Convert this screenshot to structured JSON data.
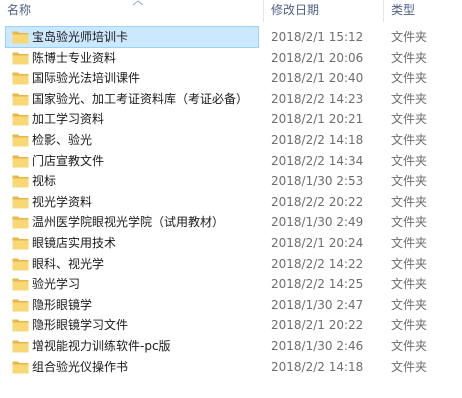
{
  "columns": {
    "name": "名称",
    "modified": "修改日期",
    "type": "类型"
  },
  "colors": {
    "header_text": "#4d6082",
    "selection_bg": "#cce8ff",
    "selection_border": "#99d1ff",
    "folder_front": "#f8d775",
    "folder_back": "#e8b649",
    "secondary_text": "#6d6d6d"
  },
  "selected_index": 0,
  "files": [
    {
      "name": "宝岛验光师培训卡",
      "date": "2018/2/1 15:12",
      "type": "文件夹",
      "icon": "folder-icon"
    },
    {
      "name": "陈博士专业资料",
      "date": "2018/2/1 20:06",
      "type": "文件夹",
      "icon": "folder-icon"
    },
    {
      "name": "国际验光法培训课件",
      "date": "2018/2/1 20:40",
      "type": "文件夹",
      "icon": "folder-icon"
    },
    {
      "name": "国家验光、加工考证资料库（考证必备）",
      "date": "2018/2/2 14:23",
      "type": "文件夹",
      "icon": "folder-icon"
    },
    {
      "name": "加工学习资料",
      "date": "2018/2/1 20:21",
      "type": "文件夹",
      "icon": "folder-icon"
    },
    {
      "name": "检影、验光",
      "date": "2018/2/2 14:18",
      "type": "文件夹",
      "icon": "folder-icon"
    },
    {
      "name": "门店宣教文件",
      "date": "2018/2/2 14:34",
      "type": "文件夹",
      "icon": "folder-icon"
    },
    {
      "name": "视标",
      "date": "2018/1/30 2:53",
      "type": "文件夹",
      "icon": "folder-icon"
    },
    {
      "name": "视光学资料",
      "date": "2018/2/2 20:22",
      "type": "文件夹",
      "icon": "folder-icon"
    },
    {
      "name": "温州医学院眼视光学院（试用教材）",
      "date": "2018/1/30 2:49",
      "type": "文件夹",
      "icon": "folder-icon"
    },
    {
      "name": "眼镜店实用技术",
      "date": "2018/2/1 20:24",
      "type": "文件夹",
      "icon": "folder-icon"
    },
    {
      "name": "眼科、视光学",
      "date": "2018/2/2 14:22",
      "type": "文件夹",
      "icon": "folder-icon"
    },
    {
      "name": "验光学习",
      "date": "2018/2/2 14:25",
      "type": "文件夹",
      "icon": "folder-icon"
    },
    {
      "name": "隐形眼镜学",
      "date": "2018/1/30 2:47",
      "type": "文件夹",
      "icon": "folder-icon"
    },
    {
      "name": "隐形眼镜学习文件",
      "date": "2018/2/1 20:22",
      "type": "文件夹",
      "icon": "folder-icon"
    },
    {
      "name": "增视能视力训练软件-pc版",
      "date": "2018/1/30 2:46",
      "type": "文件夹",
      "icon": "folder-icon"
    },
    {
      "name": "组合验光仪操作书",
      "date": "2018/2/2 14:18",
      "type": "文件夹",
      "icon": "folder-icon"
    }
  ]
}
